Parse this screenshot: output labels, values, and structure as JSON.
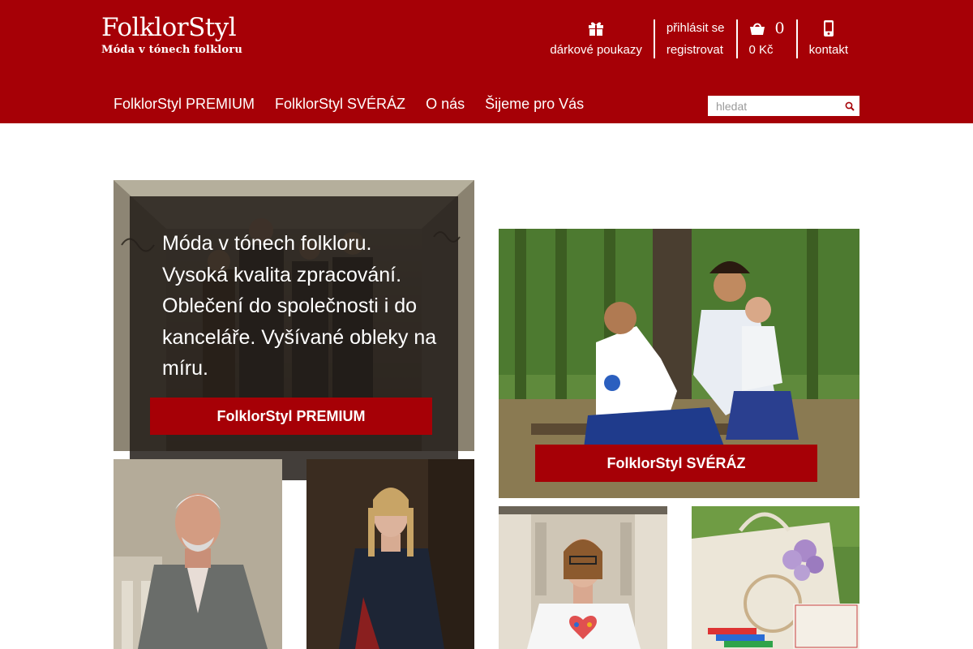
{
  "logo": {
    "title": "FolklorStyl",
    "subtitle": "Móda v tónech folkloru"
  },
  "top_links": {
    "gift": {
      "label": "dárkové poukazy",
      "icon": "gift-icon"
    },
    "login": {
      "line1": "přihlásit se",
      "line2": "registrovat"
    },
    "cart": {
      "count": "0",
      "total": "0 Kč",
      "icon": "shopping-basket-icon"
    },
    "contact": {
      "label": "kontakt",
      "icon": "mobile-phone-icon"
    }
  },
  "nav": [
    {
      "label": "FolklorStyl PREMIUM"
    },
    {
      "label": "FolklorStyl SVÉRÁZ"
    },
    {
      "label": "O nás"
    },
    {
      "label": "Šijeme pro Vás"
    }
  ],
  "search": {
    "placeholder": "hledat",
    "value": "",
    "icon": "search-icon"
  },
  "hero": {
    "text": "Móda v tónech folkloru. Vysoká kvalita zpracování. Oblečení do společnosti i do kanceláře. Vyšívané obleky na míru.",
    "button": "FolklorStyl PREMIUM"
  },
  "sveraz": {
    "button": "FolklorStyl SVÉRÁZ"
  },
  "colors": {
    "brand_red": "#a60006",
    "white": "#ffffff"
  }
}
